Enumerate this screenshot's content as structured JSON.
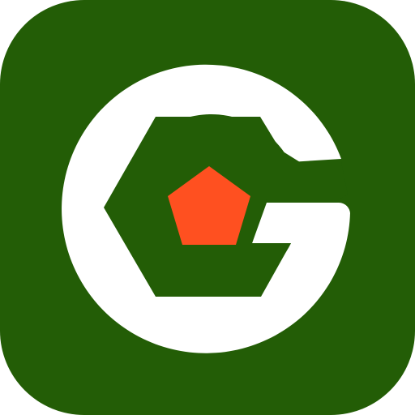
{
  "icon": {
    "name": "app-logo-icon",
    "shape": "rounded-square",
    "glyph": "letter-g-with-hexagon-and-pentagon",
    "colors": {
      "background": "#235D06",
      "ring": "#FFFFFF",
      "hexagon": "#235D06",
      "pentagon": "#FF5020"
    }
  }
}
